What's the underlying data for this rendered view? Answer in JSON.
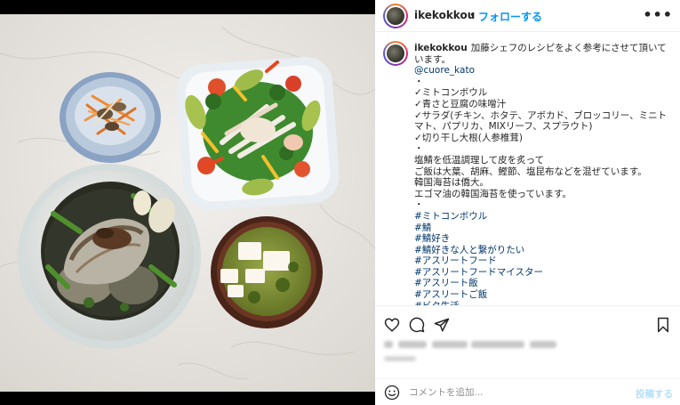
{
  "header": {
    "username": "ikekokkou",
    "separator": "•",
    "follow_label": "フォローする",
    "more_label": "•••"
  },
  "caption": {
    "username": "ikekokkou",
    "first_line": "加藤シェフのレシピをよく参考にさせて頂いています。",
    "mention": "@cuore_kato",
    "lines": [
      "・",
      "✓ミトコンボウル",
      "✓青さと豆腐の味噌汁",
      "✓サラダ(チキン、ホタテ、アボカド、ブロッコリー、ミニトマト、パプリカ、MIXリーフ、スプラウト)",
      "✓切り干し大根(人参椎茸)",
      "・",
      "塩鯖を低温調理して皮を炙って",
      "ご飯は大葉、胡麻、鰹節、塩昆布などを混ぜています。",
      "韓国海苔は僑大。",
      "エゴマ油の韓国海苔を使っています。",
      "・"
    ],
    "hashtags": [
      "#ミトコンボウル",
      "#鯖",
      "#鯖好き",
      "#鯖好きな人と繋がりたい",
      "#アスリートフード",
      "#アスリートフードマイスター",
      "#アスリート飯",
      "#アスリートご飯",
      "#ビタ生活"
    ]
  },
  "actions": {
    "icons": [
      "heart-icon",
      "comment-icon",
      "share-icon",
      "bookmark-icon"
    ]
  },
  "comment": {
    "placeholder": "コメントを追加...",
    "post_label": "投稿する"
  },
  "colors": {
    "accent": "#0095f6",
    "link": "#00376b",
    "post_disabled": "#b2dffc"
  }
}
